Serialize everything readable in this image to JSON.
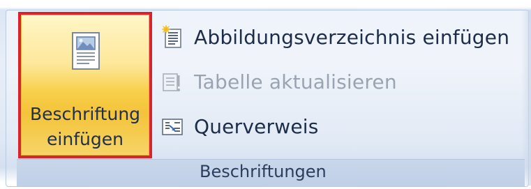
{
  "captions_group": {
    "insert_caption_button": {
      "line1": "Beschriftung",
      "line2": "einfügen"
    },
    "menu": [
      {
        "label": "Abbildungsverzeichnis einfügen",
        "icon": "table-of-figures-icon",
        "enabled": true
      },
      {
        "label": "Tabelle aktualisieren",
        "icon": "update-table-icon",
        "enabled": false
      },
      {
        "label": "Querverweis",
        "icon": "cross-reference-icon",
        "enabled": true
      }
    ],
    "group_label": "Beschriftungen"
  },
  "colors": {
    "highlight_border": "#d8242c",
    "button_gradient_top": "#fff7c8",
    "button_gradient_bottom": "#f4c33a",
    "text": "#1d2c48",
    "disabled_text": "#9aa3b0",
    "ribbon_bg": "#dce6f3"
  }
}
